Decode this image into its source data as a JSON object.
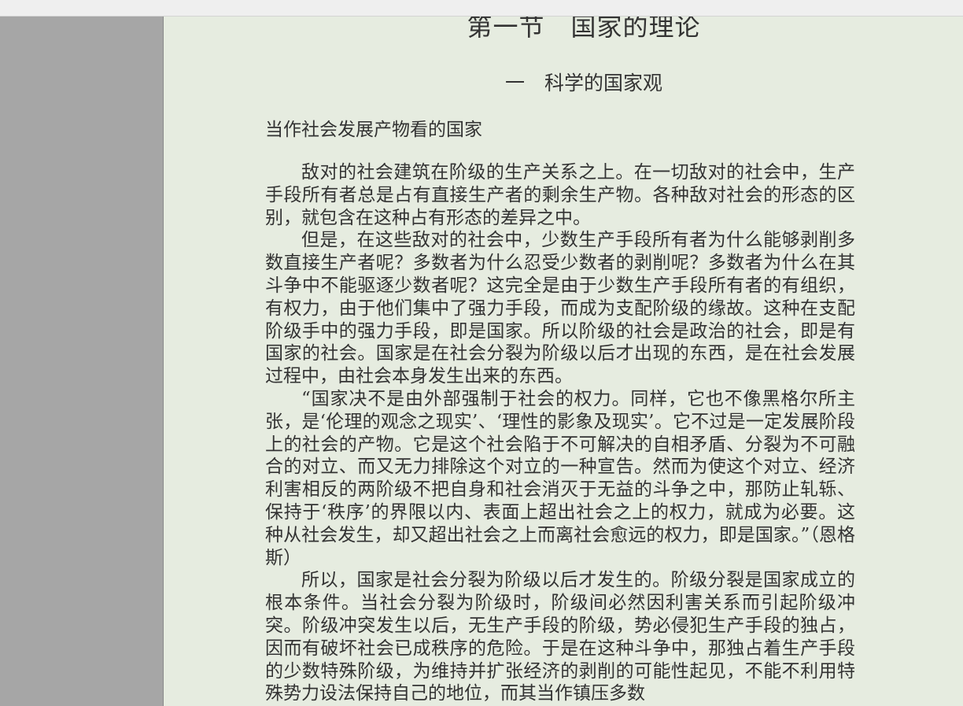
{
  "document": {
    "section_title": "第一节　国家的理论",
    "subsection_title": "一　科学的国家观",
    "topic_title": "当作社会发展产物看的国家",
    "paragraphs": [
      "敌对的社会建筑在阶级的生产关系之上。在一切敌对的社会中，生产手段所有者总是占有直接生产者的剩余生产物。各种敌对社会的形态的区别，就包含在这种占有形态的差异之中。",
      "但是，在这些敌对的社会中，少数生产手段所有者为什么能够剥削多数直接生产者呢？多数者为什么忍受少数者的剥削呢？多数者为什么在其斗争中不能驱逐少数者呢？这完全是由于少数生产手段所有者的有组织，有权力，由于他们集中了强力手段，而成为支配阶级的缘故。这种在支配阶级手中的强力手段，即是国家。所以阶级的社会是政治的社会，即是有国家的社会。国家是在社会分裂为阶级以后才出现的东西，是在社会发展过程中，由社会本身发生出来的东西。",
      "“国家决不是由外部强制于社会的权力。同样，它也不像黑格尔所主张，是‘伦理的观念之现实’、‘理性的影象及现实’。它不过是一定发展阶段上的社会的产物。它是这个社会陷于不可解决的自相矛盾、分裂为不可融合的对立、而又无力排除这个对立的一种宣告。然而为使这个对立、经济利害相反的两阶级不把自身和社会消灭于无益的斗争之中，那防止轧轹、保持于‘秩序’的界限以内、表面上超出社会之上的权力，就成为必要。这种从社会发生，却又超出社会之上而离社会愈远的权力，即是国家。”（恩格斯）",
      "所以，国家是社会分裂为阶级以后才发生的。阶级分裂是国家成立的根本条件。当社会分裂为阶级时，阶级间必然因利害关系而引起阶级冲突。阶级冲突发生以后，无生产手段的阶级，势必侵犯生产手段的独占，因而有破坏社会已成秩序的危险。于是在这种斗争中，那独占着生产手段的少数特殊阶级，为维持并扩张经济的剥削的可能性起见，不能不利用特殊势力设法保持自己的地位，而其当作镇压多数"
    ]
  }
}
